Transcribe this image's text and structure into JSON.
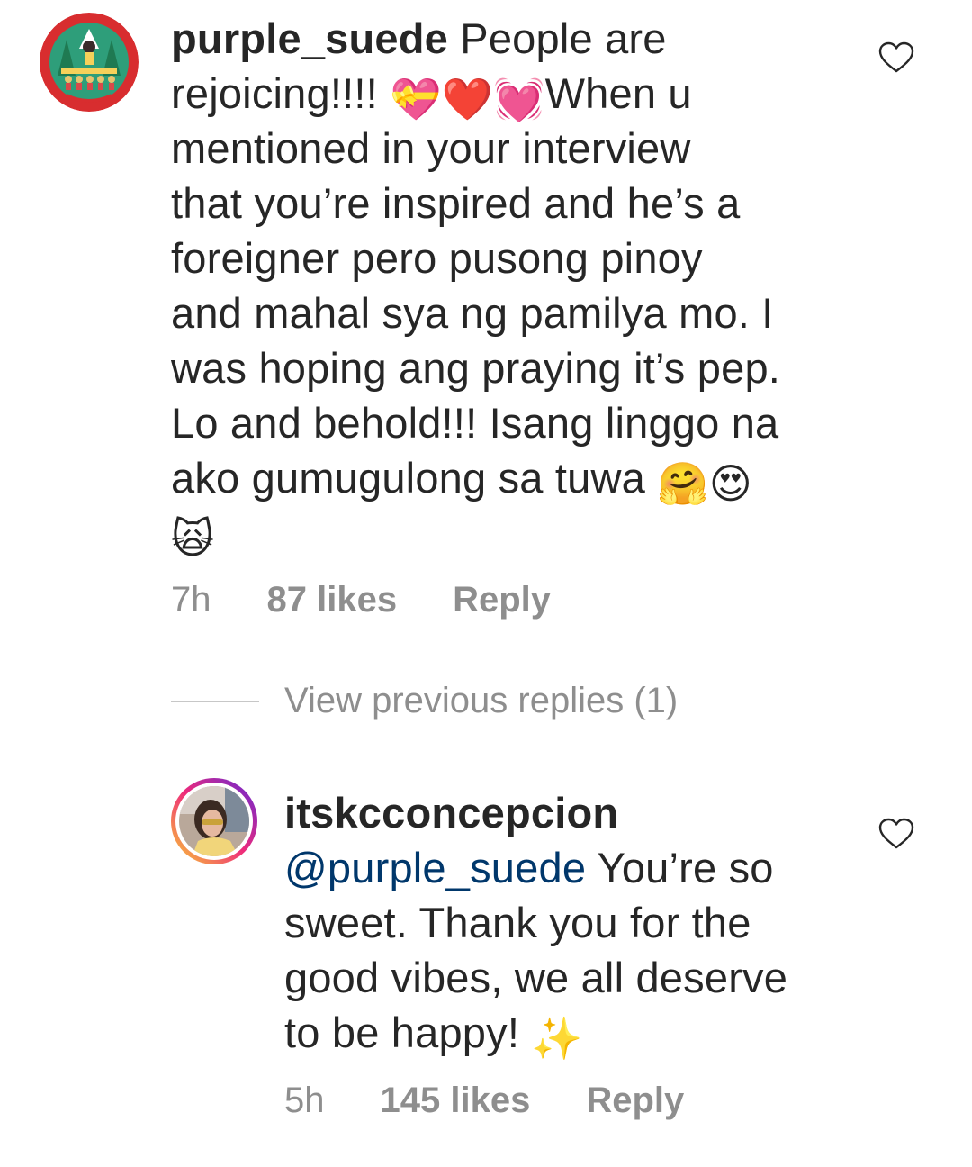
{
  "comments": [
    {
      "username": "purple_suede",
      "text_lines": [
        {
          "parts": [
            {
              "t": "People are"
            }
          ]
        },
        {
          "parts": [
            {
              "t": "rejoicing!!!! "
            },
            {
              "emoji": "💝"
            },
            {
              "emoji": "❤️"
            },
            {
              "emoji": "💓"
            },
            {
              "t": "When u"
            }
          ]
        },
        {
          "parts": [
            {
              "t": "mentioned in your interview"
            }
          ]
        },
        {
          "parts": [
            {
              "t": "that you’re inspired and he’s a"
            }
          ]
        },
        {
          "parts": [
            {
              "t": "foreigner pero pusong pinoy"
            }
          ]
        },
        {
          "parts": [
            {
              "t": "and mahal sya ng pamilya mo. I"
            }
          ]
        },
        {
          "parts": [
            {
              "t": "was hoping ang praying it’s pep."
            }
          ]
        },
        {
          "parts": [
            {
              "t": "Lo and behold!!! Isang linggo na"
            }
          ]
        },
        {
          "parts": [
            {
              "t": "ako gumugulong sa tuwa "
            },
            {
              "emoji": "🤗"
            },
            {
              "emoji": "😍"
            }
          ]
        },
        {
          "parts": [
            {
              "emoji": "🙀"
            }
          ]
        }
      ],
      "time": "7h",
      "likes": "87 likes",
      "reply": "Reply"
    },
    {
      "username": "itskcconcepcion",
      "mention": "@purple_suede",
      "text_lines": [
        {
          "parts": [
            {
              "t": " You’re so"
            }
          ]
        },
        {
          "parts": [
            {
              "t": "sweet. Thank you for the"
            }
          ]
        },
        {
          "parts": [
            {
              "t": "good vibes, we all deserve"
            }
          ]
        },
        {
          "parts": [
            {
              "t": "to be happy! "
            },
            {
              "emoji": "✨"
            }
          ]
        }
      ],
      "time": "5h",
      "likes": "145 likes",
      "reply": "Reply"
    }
  ],
  "view_previous_replies": "View previous replies (1)",
  "icons": {
    "like": "heart-outline-icon",
    "avatar1": "christmas-illustration-avatar",
    "avatar2": "profile-photo-avatar"
  },
  "colors": {
    "text": "#262626",
    "secondary": "#8e8e8e",
    "mention": "#00376b",
    "story_ring_start": "#f9ce34",
    "story_ring_mid": "#ee2a7b",
    "story_ring_end": "#6228d7"
  }
}
